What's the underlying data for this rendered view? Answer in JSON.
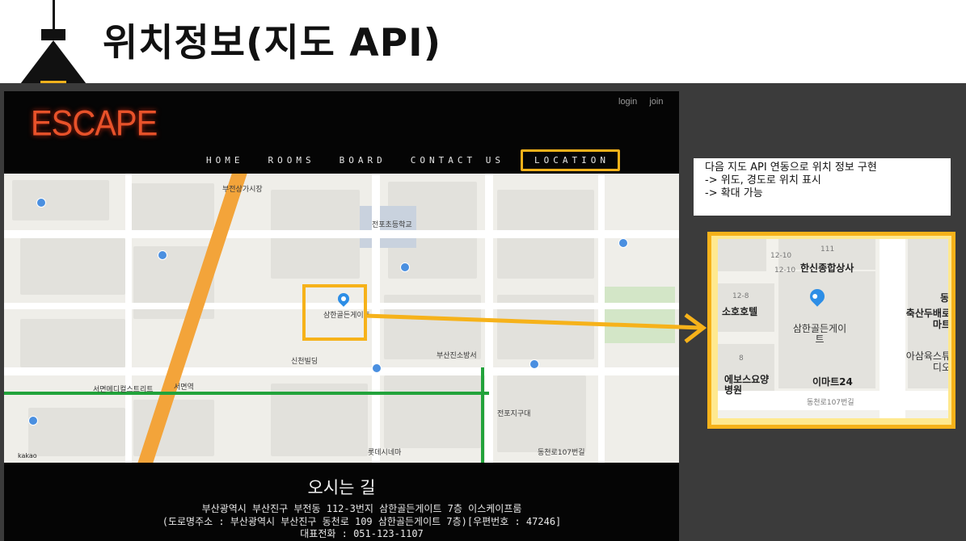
{
  "slide": {
    "title": "위치정보(지도 API)"
  },
  "website": {
    "header_links": [
      "login",
      "join"
    ],
    "logo": "ESCAPE",
    "nav": [
      {
        "label": "HOME"
      },
      {
        "label": "ROOMS"
      },
      {
        "label": "BOARD"
      },
      {
        "label": "CONTACT US"
      },
      {
        "label": "LOCATION",
        "active": true
      }
    ],
    "map": {
      "labels": [
        "부전상가시장",
        "삼한골든게이트",
        "서면역",
        "전포초등학교",
        "롯데시네마",
        "동천로107번길",
        "신천빌딩",
        "서면메디컬스트리트",
        "전포지구대",
        "부산진소방서"
      ],
      "scale": "kakao",
      "marker_label": "삼한골든게이트"
    },
    "directions_title": "오시는 길",
    "address_line1": "부산광역시 부산진구 부전동 112-3번지 삼한골든게이트 7층 이스케이프룸",
    "address_line2": "(도로명주소 : 부산광역시 부산진구 동천로 109 삼한골든게이트 7층)[우편번호 : 47246]",
    "phone_line": "대표전화 : 051-123-1107"
  },
  "annotation": {
    "lines": [
      "다음 지도 API 연동으로 위치 정보 구현",
      "-> 위도, 경도로 위치 표시",
      "-> 확대 가능"
    ]
  },
  "zoom": {
    "labels": {
      "lot_a": "12-10",
      "lot_b": "111",
      "lot_c": "12-10",
      "building": "한신종합상사",
      "lot_d": "12-8",
      "hotel": "소호호텔",
      "target": "삼한골든게이트",
      "mart_a": "축산두배로마트",
      "cafe": "아삼육스튜디오",
      "hospital_num": "8",
      "hospital": "에보스요양병원",
      "emart": "이마트24",
      "street": "동천로107번길",
      "partial": "동"
    }
  },
  "colors": {
    "accent": "#f6b21a",
    "logo": "#e8522a",
    "panel": "#3b3b3b",
    "pin": "#2d8ee6"
  }
}
